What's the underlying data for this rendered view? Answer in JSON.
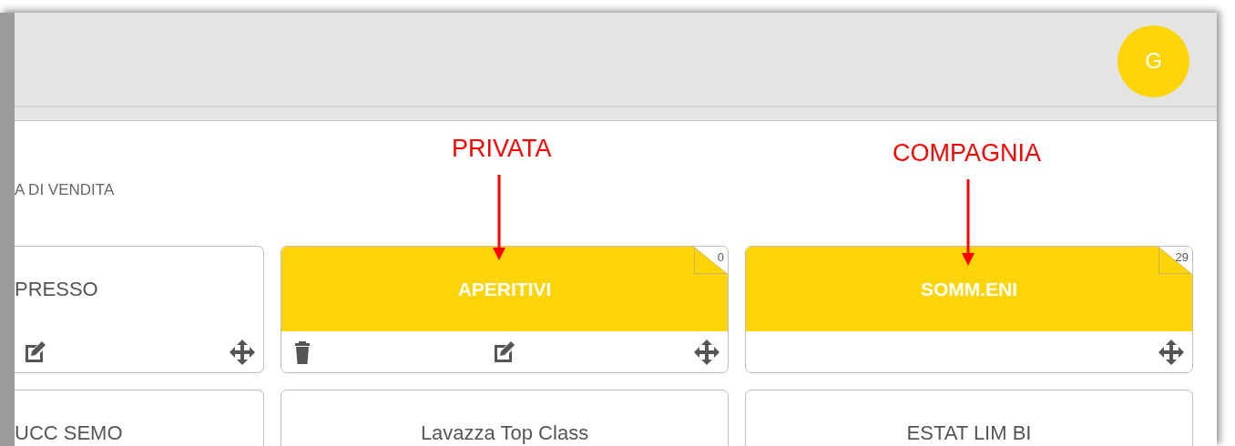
{
  "header": {
    "avatar": {
      "initial": "G"
    }
  },
  "section_title": "A DI VENDITA",
  "rows": [
    [
      {
        "title": "PRESSO",
        "kind": "plain",
        "cut": true,
        "actions": [
          {
            "kind": "edit"
          },
          {
            "kind": "move"
          }
        ]
      },
      {
        "title": "APERITIVI",
        "kind": "highlighted",
        "cut": false,
        "count": "0",
        "actions": [
          {
            "kind": "delete"
          },
          {
            "kind": "edit"
          },
          {
            "kind": "move"
          }
        ]
      },
      {
        "title": "SOMM.ENI",
        "kind": "highlighted",
        "cut": false,
        "count": "29",
        "actions": [
          {
            "kind": "move"
          }
        ]
      }
    ],
    [
      {
        "title": "UCC SEMO",
        "kind": "plain",
        "cut": true
      },
      {
        "title": "Lavazza Top Class",
        "kind": "plain",
        "cut": false
      },
      {
        "title": "ESTAT LIM BI",
        "kind": "plain",
        "cut": false
      }
    ]
  ],
  "annotations": [
    {
      "text": "PRIVATA"
    },
    {
      "text": "COMPAGNIA"
    }
  ]
}
